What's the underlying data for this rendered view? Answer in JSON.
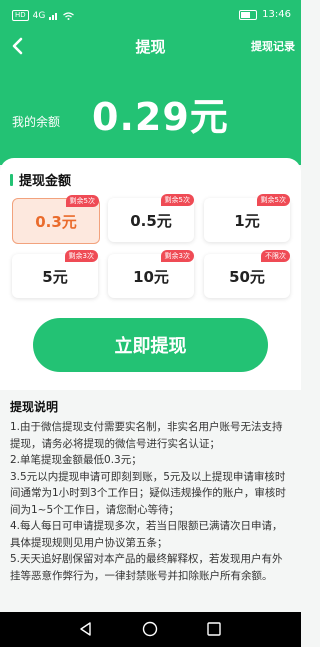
{
  "status_bar": {
    "left_badge": "HD",
    "signal": "4G",
    "time": "13:46"
  },
  "header": {
    "title": "提现",
    "record_link": "提现记录",
    "balance_label": "我的余额",
    "balance_value": "0.29元"
  },
  "amounts": {
    "section_title": "提现金额",
    "options": [
      {
        "label": "0.3元",
        "tag": "剩余5次",
        "selected": true
      },
      {
        "label": "0.5元",
        "tag": "剩余5次",
        "selected": false
      },
      {
        "label": "1元",
        "tag": "剩余5次",
        "selected": false
      },
      {
        "label": "5元",
        "tag": "剩余3次",
        "selected": false
      },
      {
        "label": "10元",
        "tag": "剩余3次",
        "selected": false
      },
      {
        "label": "50元",
        "tag": "不限次",
        "selected": false
      }
    ]
  },
  "cta": {
    "label": "立即提现"
  },
  "notes": {
    "title": "提现说明",
    "items": [
      "1.由于微信提现支付需要实名制，非实名用户账号无法支持提现，请务必将提现的微信号进行实名认证；",
      "2.单笔提现金额最低0.3元；",
      "3.5元以内提现申请可即刻到账，5元及以上提现申请审核时间通常为1小时到3个工作日；疑似违规操作的账户，审核时间为1~5个工作日，请您耐心等待；",
      "4.每人每日可申请提现多次，若当日限额已满请次日申请，具体提现规则见用户协议第五条；",
      "5.天天追好剧保留对本产品的最终解释权，若发现用户有外挂等恶意作弊行为，一律封禁账号并扣除账户所有余额。"
    ]
  },
  "colors": {
    "brand": "#23c274",
    "selected_bg": "#fde8de",
    "selected_text": "#ea6b2c",
    "tag": "#ef4b55"
  },
  "icons": [
    "back-arrow-icon",
    "nav-back-icon",
    "nav-home-icon",
    "nav-recent-icon"
  ]
}
